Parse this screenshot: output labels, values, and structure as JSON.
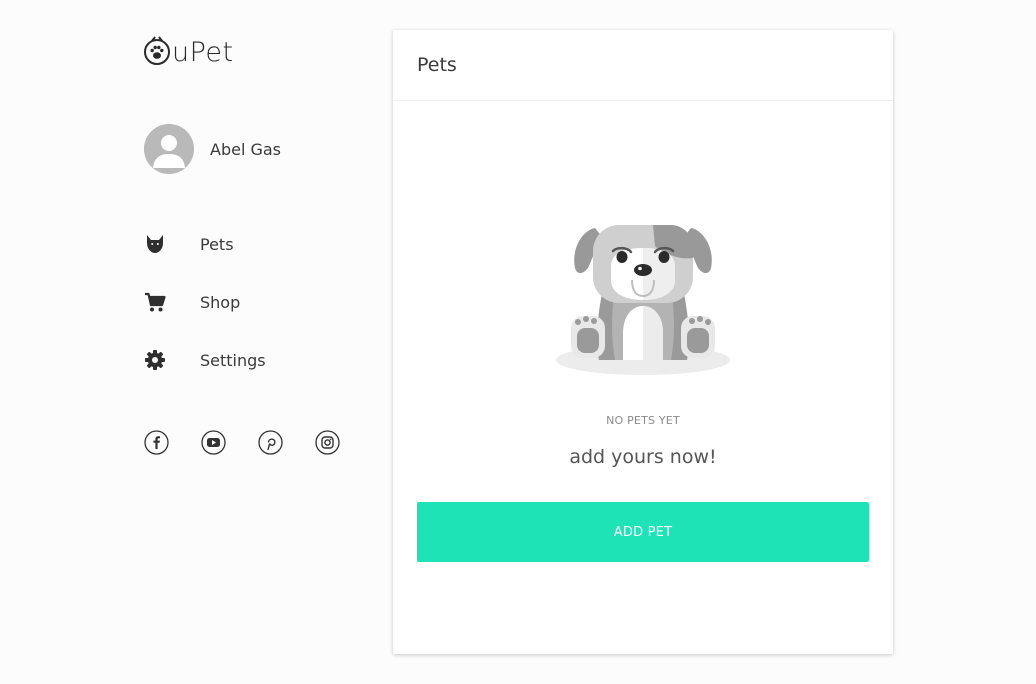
{
  "brand": {
    "logo_text": "uPet"
  },
  "user": {
    "name": "Abel Gas"
  },
  "nav": {
    "items": [
      {
        "label": "Pets",
        "icon": "dog-head-icon"
      },
      {
        "label": "Shop",
        "icon": "cart-icon"
      },
      {
        "label": "Settings",
        "icon": "gear-icon"
      }
    ]
  },
  "social": [
    "facebook-icon",
    "youtube-icon",
    "pinterest-icon",
    "instagram-icon"
  ],
  "card": {
    "title": "Pets",
    "empty_title": "NO PETS YET",
    "empty_subtitle": "add yours now!",
    "add_button_label": "ADD PET"
  },
  "colors": {
    "accent": "#1de3b7",
    "background": "#fcfcfc",
    "card": "#ffffff",
    "text": "#3a3a3a"
  }
}
